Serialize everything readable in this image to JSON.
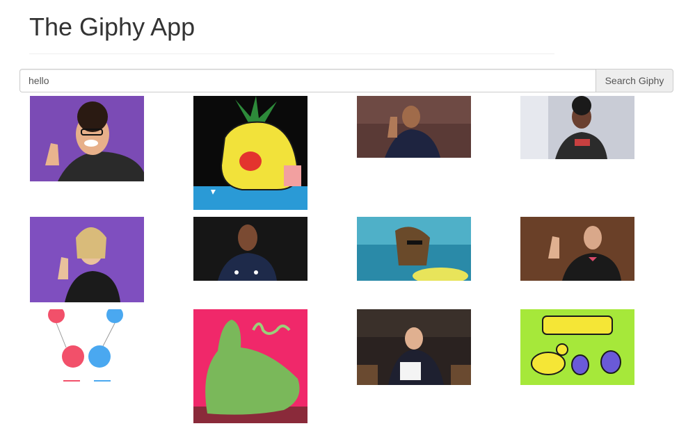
{
  "app": {
    "title": "The Giphy App"
  },
  "search": {
    "value": "hello",
    "button_label": "Search Giphy"
  },
  "results": [
    {
      "name": "man-waving-purple-gif",
      "colors": {
        "bg": "#7b4bb5",
        "accent": "#2a2a2a"
      }
    },
    {
      "name": "pineapple-cartoon-gif",
      "colors": {
        "bg": "#0a0a0a",
        "accent": "#f2e23a"
      }
    },
    {
      "name": "man-waving-dark-gif",
      "colors": {
        "bg": "#5a3a36",
        "accent": "#1e2440"
      }
    },
    {
      "name": "woman-waving-room-gif",
      "colors": {
        "bg": "#c9ccd6",
        "accent": "#2b2b2b"
      }
    },
    {
      "name": "woman-waving-purple-gif",
      "colors": {
        "bg": "#7f4fbf",
        "accent": "#1b1b1b"
      }
    },
    {
      "name": "man-sweater-gif",
      "colors": {
        "bg": "#161616",
        "accent": "#1e2a4a"
      }
    },
    {
      "name": "woman-pool-sunglasses-gif",
      "colors": {
        "bg": "#2a8aa8",
        "accent": "#6a4a2a"
      }
    },
    {
      "name": "man-waving-bowtie-gif",
      "colors": {
        "bg": "#6a4028",
        "accent": "#1a1a1a"
      }
    },
    {
      "name": "balloon-characters-gif",
      "colors": {
        "bg": "#ffffff",
        "accent": "#f2506a",
        "accent2": "#4aa8f0"
      }
    },
    {
      "name": "green-figure-hello-gif",
      "colors": {
        "bg": "#f0286a",
        "accent": "#7ab85a"
      }
    },
    {
      "name": "late-show-hi-gif",
      "colors": {
        "bg": "#2a2220",
        "accent": "#1e2030"
      }
    },
    {
      "name": "hello-cartoon-bugs-gif",
      "colors": {
        "bg": "#a6e83a",
        "accent": "#f5e636"
      }
    }
  ]
}
